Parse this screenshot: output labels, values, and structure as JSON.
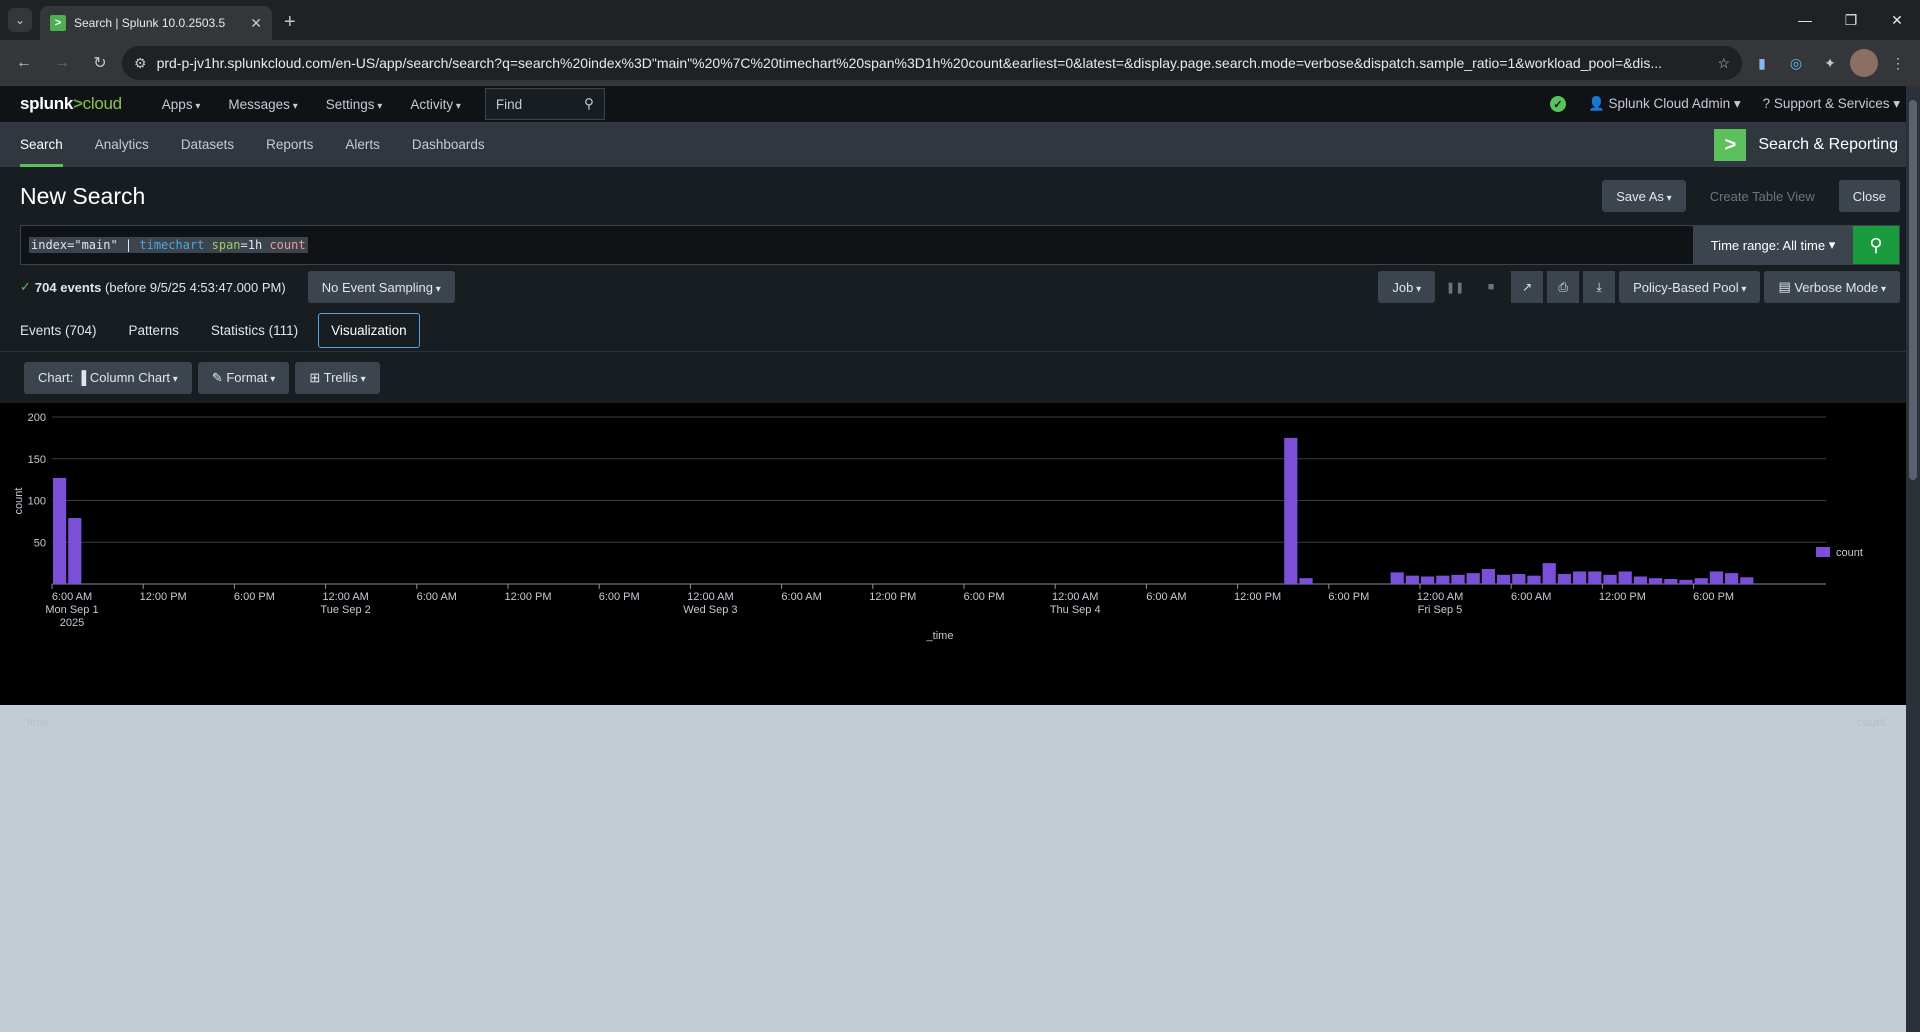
{
  "browser": {
    "tab_title": "Search | Splunk 10.0.2503.5",
    "url": "prd-p-jv1hr.splunkcloud.com/en-US/app/search/search?q=search%20index%3D\"main\"%20%7C%20timechart%20span%3D1h%20count&earliest=0&latest=&display.page.search.mode=verbose&dispatch.sample_ratio=1&workload_pool=&dis..."
  },
  "topbar": {
    "logo_a": "splunk",
    "logo_gt": ">",
    "logo_b": "cloud",
    "menu": [
      "Apps",
      "Messages",
      "Settings",
      "Activity"
    ],
    "find_placeholder": "Find",
    "user": "Splunk Cloud Admin",
    "support": "Support & Services"
  },
  "appnav": {
    "items": [
      "Search",
      "Analytics",
      "Datasets",
      "Reports",
      "Alerts",
      "Dashboards"
    ],
    "app_name": "Search & Reporting"
  },
  "search": {
    "title": "New Search",
    "save_as": "Save As",
    "create_table": "Create Table View",
    "close": "Close",
    "q_index": "index=\"main\" | ",
    "q_cmd": "timechart",
    "q_arg": " span",
    "q_val": "=1h ",
    "q_fn": "count",
    "time_range": "Time range: All time"
  },
  "status": {
    "events": "704 events",
    "before": "(before 9/5/25 4:53:47.000 PM)",
    "sampling": "No Event Sampling",
    "job": "Job",
    "pool": "Policy-Based Pool",
    "mode": "Verbose Mode"
  },
  "tabs": [
    "Events (704)",
    "Patterns",
    "Statistics (111)",
    "Visualization"
  ],
  "viz": {
    "chart_btn": "Chart: ▐ Column Chart",
    "format_btn": "✎ Format",
    "trellis_btn": "⊞ Trellis"
  },
  "results_ghost": {
    "col_time": "_time",
    "col_count": "count"
  },
  "chart_data": {
    "type": "bar",
    "xlabel": "_time",
    "ylabel": "count",
    "ylim": [
      0,
      200
    ],
    "yticks": [
      50,
      100,
      150,
      200
    ],
    "legend": "count",
    "legend_position": "right",
    "series_color": "#7b4fd8",
    "xticks": [
      [
        "6:00 AM",
        "Mon Sep 1",
        "2025"
      ],
      [
        "12:00 PM",
        "",
        ""
      ],
      [
        "6:00 PM",
        "",
        ""
      ],
      [
        "12:00 AM",
        "Tue Sep 2",
        ""
      ],
      [
        "6:00 AM",
        "",
        ""
      ],
      [
        "12:00 PM",
        "",
        ""
      ],
      [
        "6:00 PM",
        "",
        ""
      ],
      [
        "12:00 AM",
        "Wed Sep 3",
        ""
      ],
      [
        "6:00 AM",
        "",
        ""
      ],
      [
        "12:00 PM",
        "",
        ""
      ],
      [
        "6:00 PM",
        "",
        ""
      ],
      [
        "12:00 AM",
        "Thu Sep 4",
        ""
      ],
      [
        "6:00 AM",
        "",
        ""
      ],
      [
        "12:00 PM",
        "",
        ""
      ],
      [
        "6:00 PM",
        "",
        ""
      ],
      [
        "12:00 AM",
        "Fri Sep 5",
        ""
      ],
      [
        "6:00 AM",
        "",
        ""
      ],
      [
        "12:00 PM",
        "",
        ""
      ],
      [
        "6:00 PM",
        "",
        ""
      ]
    ],
    "bars": [
      {
        "t": "2025-09-01 06:00",
        "v": 127
      },
      {
        "t": "2025-09-01 07:00",
        "v": 79
      },
      {
        "t": "2025-09-04 15:00",
        "v": 175
      },
      {
        "t": "2025-09-04 16:00",
        "v": 7
      },
      {
        "t": "2025-09-04 22:00",
        "v": 14
      },
      {
        "t": "2025-09-04 23:00",
        "v": 10
      },
      {
        "t": "2025-09-05 00:00",
        "v": 9
      },
      {
        "t": "2025-09-05 01:00",
        "v": 10
      },
      {
        "t": "2025-09-05 02:00",
        "v": 11
      },
      {
        "t": "2025-09-05 03:00",
        "v": 13
      },
      {
        "t": "2025-09-05 04:00",
        "v": 18
      },
      {
        "t": "2025-09-05 05:00",
        "v": 11
      },
      {
        "t": "2025-09-05 06:00",
        "v": 12
      },
      {
        "t": "2025-09-05 07:00",
        "v": 10
      },
      {
        "t": "2025-09-05 08:00",
        "v": 25
      },
      {
        "t": "2025-09-05 09:00",
        "v": 12
      },
      {
        "t": "2025-09-05 10:00",
        "v": 15
      },
      {
        "t": "2025-09-05 11:00",
        "v": 15
      },
      {
        "t": "2025-09-05 12:00",
        "v": 11
      },
      {
        "t": "2025-09-05 13:00",
        "v": 15
      },
      {
        "t": "2025-09-05 14:00",
        "v": 9
      },
      {
        "t": "2025-09-05 15:00",
        "v": 7
      },
      {
        "t": "2025-09-05 16:00",
        "v": 6
      },
      {
        "t": "2025-09-05 17:00",
        "v": 5
      },
      {
        "t": "2025-09-05 18:00",
        "v": 7
      },
      {
        "t": "2025-09-05 19:00",
        "v": 15
      },
      {
        "t": "2025-09-05 20:00",
        "v": 13
      },
      {
        "t": "2025-09-05 21:00",
        "v": 8
      }
    ]
  }
}
